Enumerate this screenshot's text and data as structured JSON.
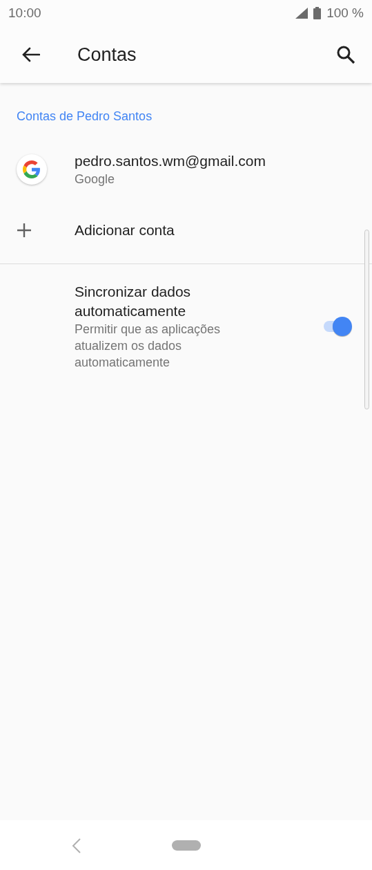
{
  "status_bar": {
    "time": "10:00",
    "battery": "100 %"
  },
  "app_bar": {
    "title": "Contas"
  },
  "section": {
    "title": "Contas de Pedro Santos"
  },
  "accounts": [
    {
      "email": "pedro.santos.wm@gmail.com",
      "type": "Google"
    }
  ],
  "add_account": {
    "label": "Adicionar conta"
  },
  "settings": [
    {
      "kind": "toggle",
      "title": "Sincronizar dados automaticamente",
      "summary": "Permitir que as aplicações atualizem os dados automaticamente",
      "on": true
    }
  ]
}
